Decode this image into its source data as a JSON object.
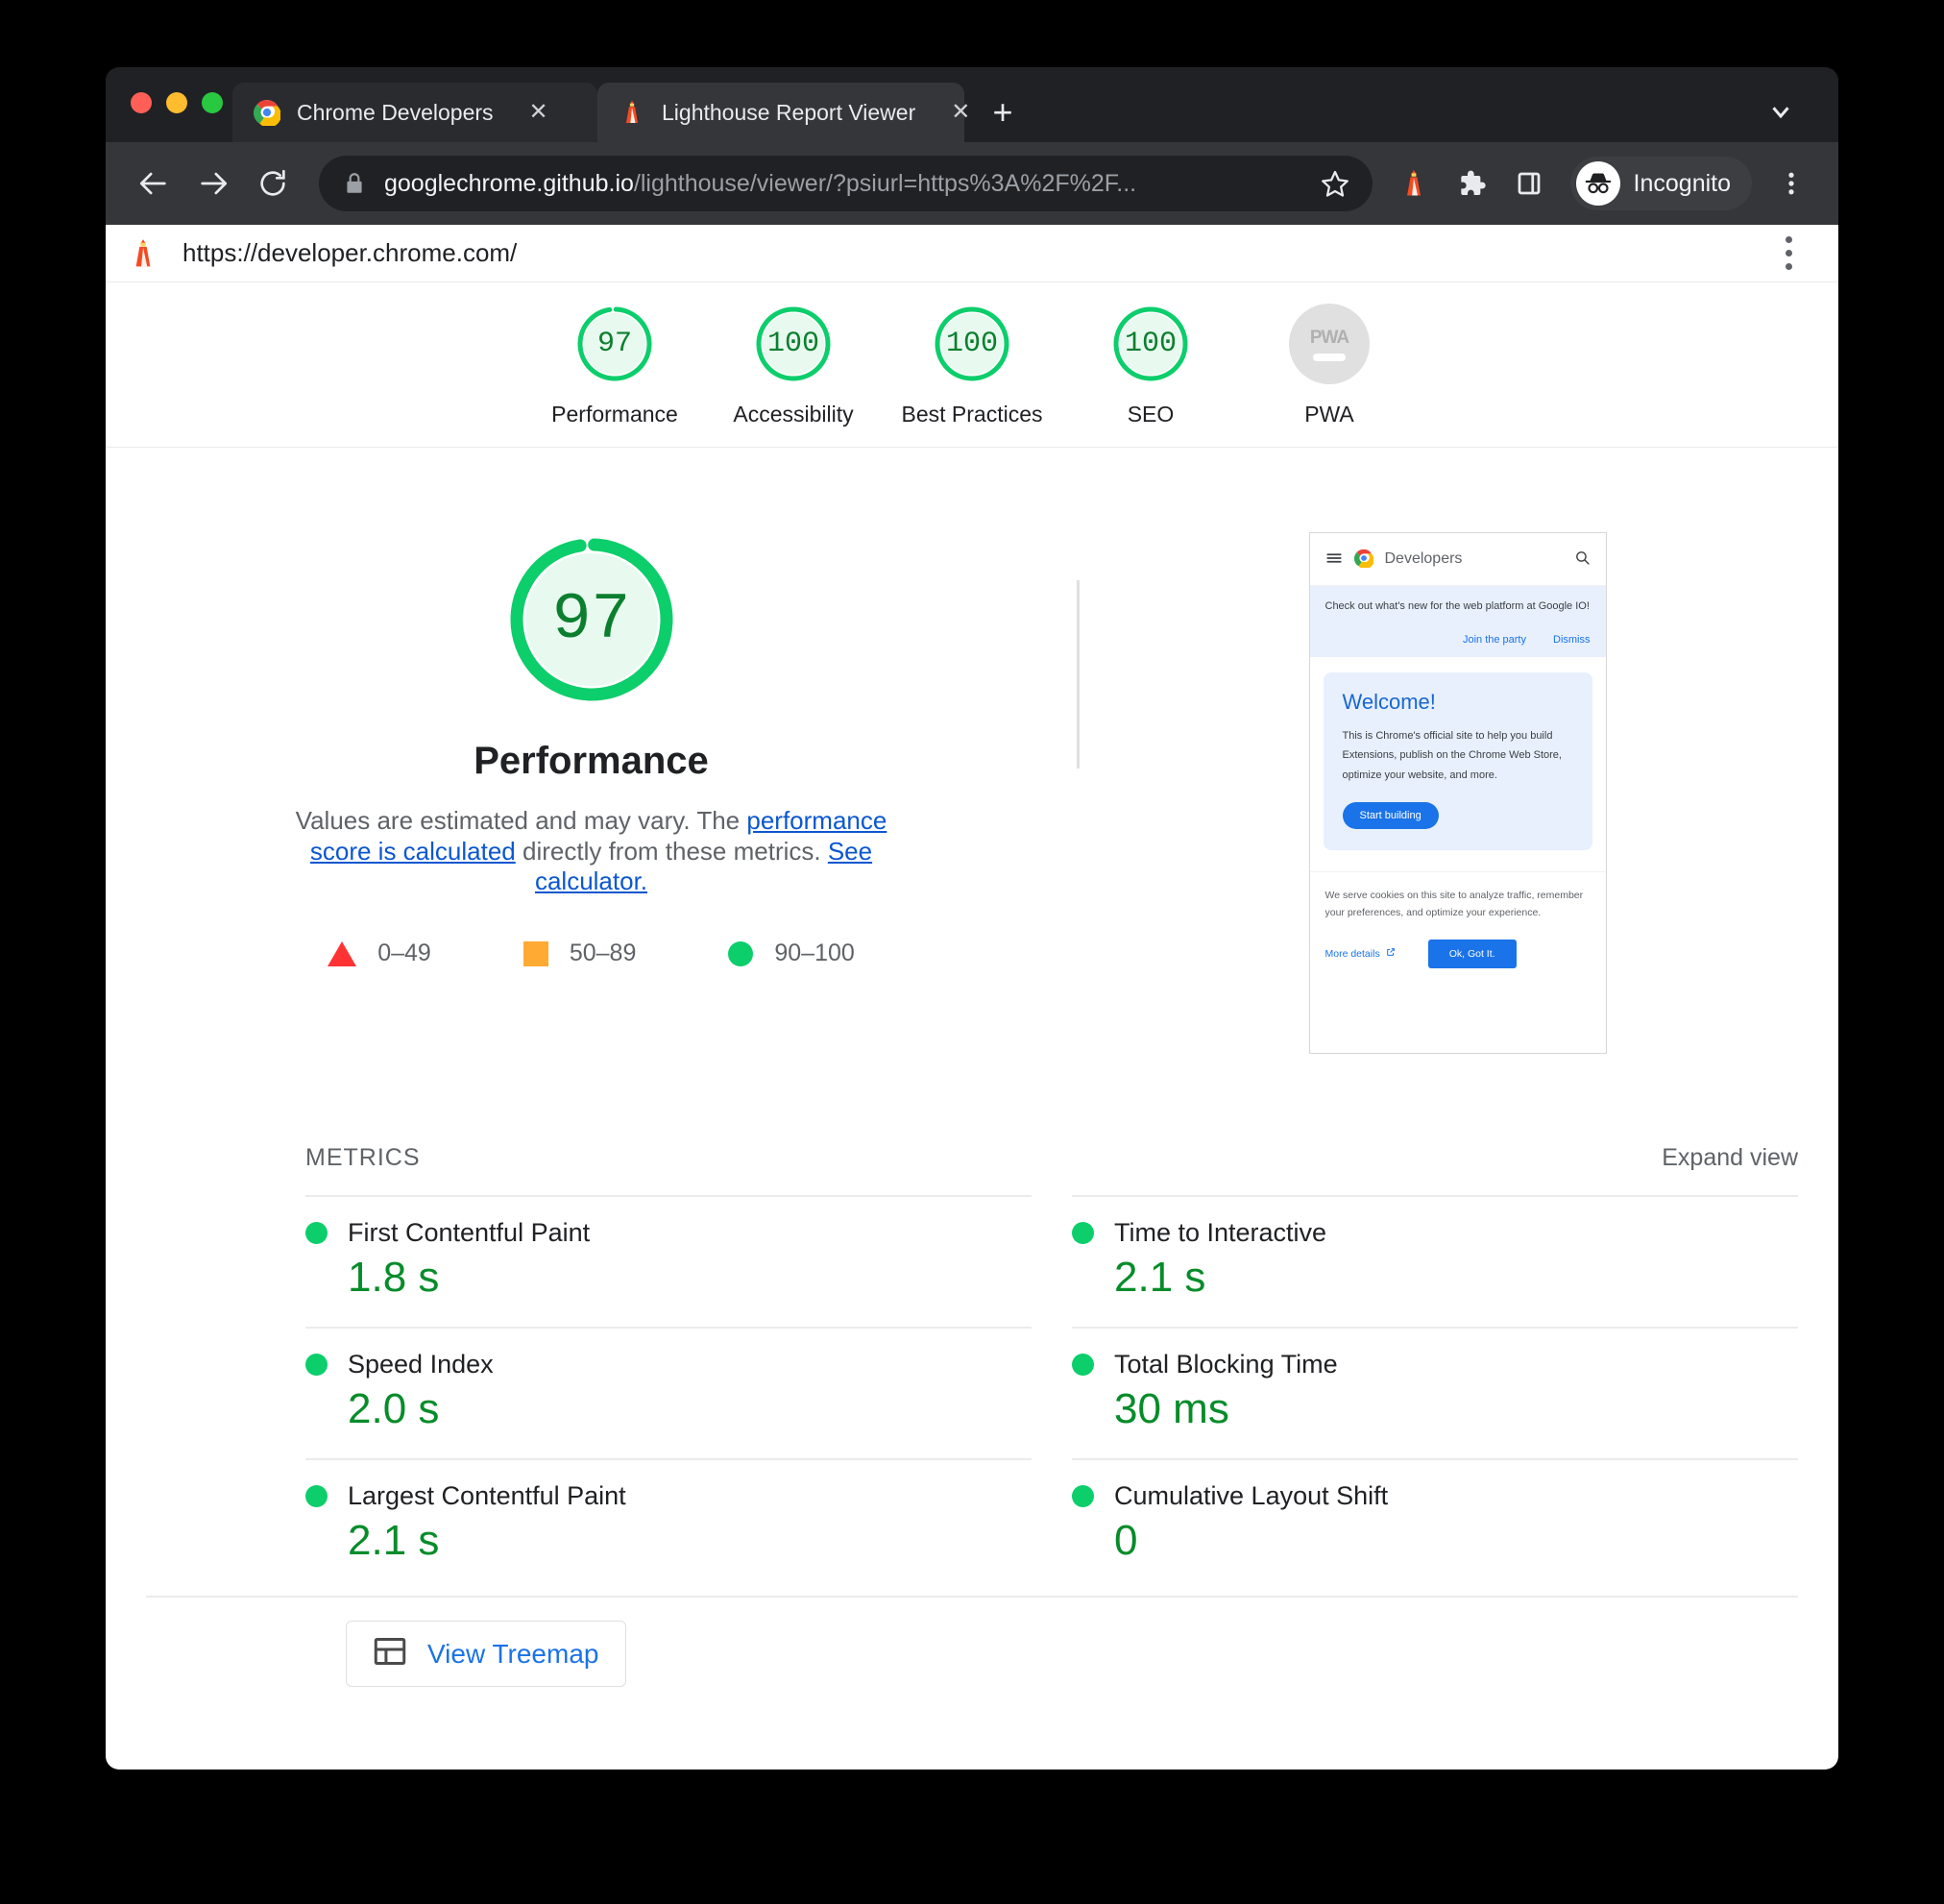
{
  "browser": {
    "tabs": [
      {
        "title": "Chrome Developers",
        "favicon": "chrome-icon",
        "close_label": "✕",
        "active": false
      },
      {
        "title": "Lighthouse Report Viewer",
        "favicon": "lighthouse-icon",
        "close_label": "✕",
        "active": true
      }
    ],
    "new_tab_label": "+",
    "omnibox": {
      "url_host": "googlechrome.github.io",
      "url_path": "/lighthouse/viewer/?psiurl=https%3A%2F%2F...",
      "lock_icon": "lock-icon",
      "star_icon": "star-icon"
    },
    "toolbar_icons": [
      "lighthouse-extension-icon",
      "extensions-puzzle-icon",
      "side-panel-icon"
    ],
    "profile_pill": {
      "label": "Incognito",
      "icon": "incognito-icon"
    },
    "menu_icon": "kebab-menu-icon"
  },
  "report": {
    "url": "https://developer.chrome.com/",
    "favicon": "lighthouse-icon",
    "menu_icon": "kebab-menu-icon",
    "category_scores": [
      {
        "label": "Performance",
        "score": "97",
        "pct": 97
      },
      {
        "label": "Accessibility",
        "score": "100",
        "pct": 100
      },
      {
        "label": "Best Practices",
        "score": "100",
        "pct": 100
      },
      {
        "label": "SEO",
        "score": "100",
        "pct": 100
      }
    ],
    "pwa": {
      "label": "PWA",
      "badge_text": "PWA",
      "state": "not-applicable"
    },
    "hero": {
      "score": "97",
      "title": "Performance",
      "desc_pre": "Values are estimated and may vary. The ",
      "desc_link1": "performance score is calculated",
      "desc_mid": " directly from these metrics. ",
      "desc_link2": "See calculator."
    },
    "legend": [
      {
        "shape": "triangle",
        "range": "0–49",
        "color": "#ff3333"
      },
      {
        "shape": "square",
        "range": "50–89",
        "color": "#ffaa33"
      },
      {
        "shape": "circle",
        "range": "90–100",
        "color": "#0cce6b"
      }
    ],
    "metrics_label": "METRICS",
    "expand_view": "Expand view",
    "metrics": [
      {
        "name": "First Contentful Paint",
        "value": "1.8 s",
        "rating": "pass"
      },
      {
        "name": "Time to Interactive",
        "value": "2.1 s",
        "rating": "pass"
      },
      {
        "name": "Speed Index",
        "value": "2.0 s",
        "rating": "pass"
      },
      {
        "name": "Total Blocking Time",
        "value": "30 ms",
        "rating": "pass"
      },
      {
        "name": "Largest Contentful Paint",
        "value": "2.1 s",
        "rating": "pass"
      },
      {
        "name": "Cumulative Layout Shift",
        "value": "0",
        "rating": "pass"
      }
    ],
    "treemap_button": {
      "label": "View Treemap",
      "icon": "treemap-icon"
    }
  },
  "thumbnail": {
    "brand": "Developers",
    "menu_icon": "hamburger-icon",
    "search_icon": "search-icon",
    "logo_icon": "chrome-icon",
    "banner_text": "Check out what's new for the web platform at Google IO!",
    "banner_action_1": "Join the party",
    "banner_action_2": "Dismiss",
    "card_heading": "Welcome!",
    "card_body": "This is Chrome's official site to help you build Extensions, publish on the Chrome Web Store, optimize your website, and more.",
    "card_button": "Start building",
    "cookie_text": "We serve cookies on this site to analyze traffic, remember your preferences, and optimize your experience.",
    "cookie_more": "More details",
    "cookie_ok": "Ok, Got It."
  },
  "colors": {
    "pass_green": "#0cce6b",
    "score_green": "#0b7f2e",
    "average_orange": "#ffaa33",
    "fail_red": "#ff3333",
    "link_blue": "#0b57d0"
  }
}
